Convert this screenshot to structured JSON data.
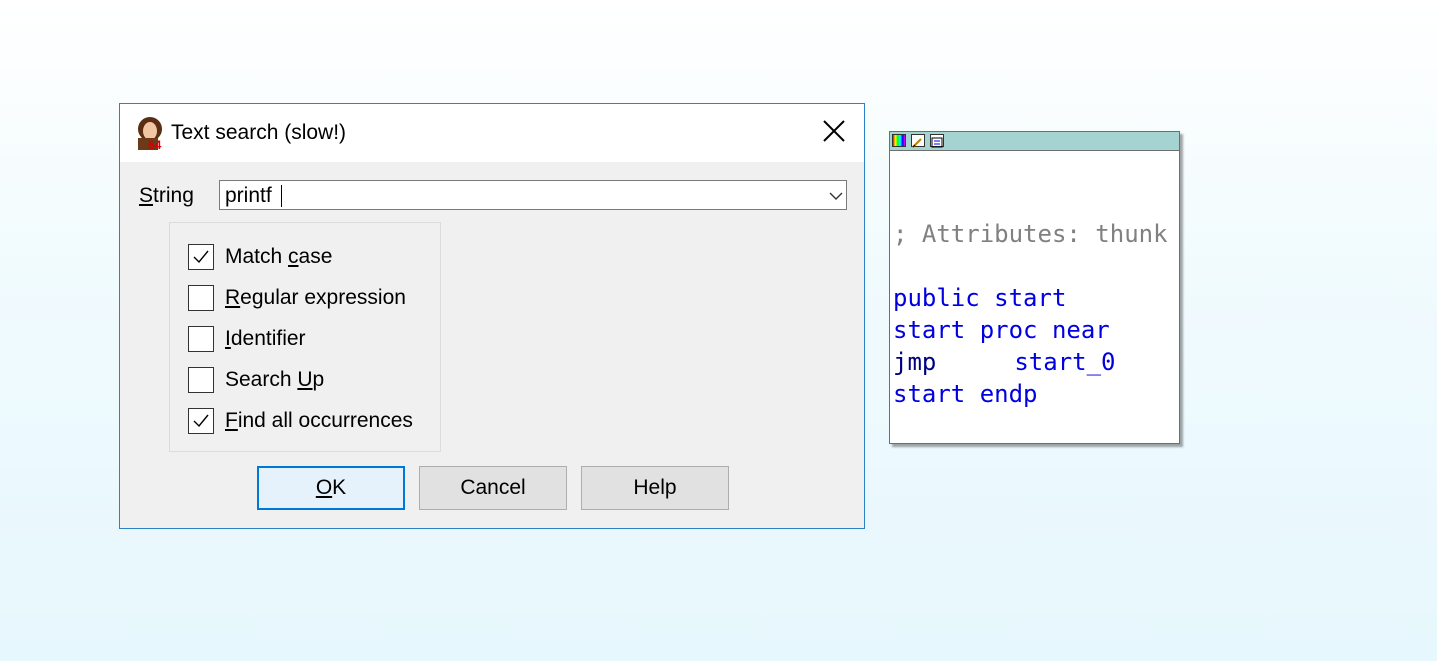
{
  "dialog": {
    "title": "Text search (slow!)",
    "string_label_prefix": "",
    "string_label_mnemonic": "S",
    "string_label_rest": "tring",
    "string_value": "printf",
    "options": [
      {
        "pre": "Match ",
        "mn": "c",
        "post": "ase",
        "checked": true
      },
      {
        "pre": "",
        "mn": "R",
        "post": "egular expression",
        "checked": false
      },
      {
        "pre": "",
        "mn": "I",
        "post": "dentifier",
        "checked": false
      },
      {
        "pre": "Search ",
        "mn": "U",
        "post": "p",
        "checked": false
      },
      {
        "pre": "",
        "mn": "F",
        "post": "ind all occurrences",
        "checked": true
      }
    ],
    "buttons": {
      "ok_mn": "O",
      "ok_rest": "K",
      "cancel": "Cancel",
      "help": "Help"
    }
  },
  "graph_node": {
    "comment": "; Attributes: thunk",
    "line1": "public start",
    "line2": "start proc near",
    "line3_mnemonic": "jmp",
    "line3_operand": "start_0",
    "line4": "start endp"
  }
}
